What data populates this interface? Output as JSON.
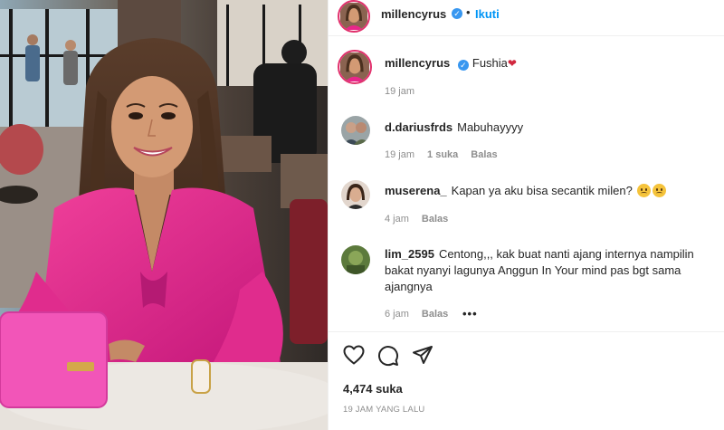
{
  "post": {
    "username": "millencyrus",
    "follow_label": "Ikuti",
    "separator": "•",
    "caption": "Fushia",
    "caption_time": "19 jam"
  },
  "comments": [
    {
      "username": "d.dariusfrds",
      "text": "Mabuhayyyy",
      "time": "19 jam",
      "likes": "1 suka",
      "reply": "Balas"
    },
    {
      "username": "muserena_",
      "text": "Kapan ya aku bisa secantik milen?",
      "time": "4 jam",
      "reply": "Balas"
    },
    {
      "username": "lim_2595",
      "text": "Centong,,, kak buat nanti ajang internya nampilin bakat nyanyi lagunya Anggun In Your mind pas bgt sama ajangnya",
      "time": "6 jam",
      "reply": "Balas",
      "more": "•••"
    }
  ],
  "footer": {
    "likes": "4,474 suka",
    "posted": "19 JAM YANG LALU"
  },
  "colors": {
    "link_blue": "#0095f6",
    "verified_blue": "#3897f0",
    "muted": "#8e8e8e",
    "dress_pink": "#e8268a"
  },
  "icons": [
    "verified-icon",
    "heart-emoji-icon",
    "sad-face-emoji-icon",
    "like-heart-icon",
    "comment-icon",
    "share-icon",
    "more-options-icon"
  ]
}
